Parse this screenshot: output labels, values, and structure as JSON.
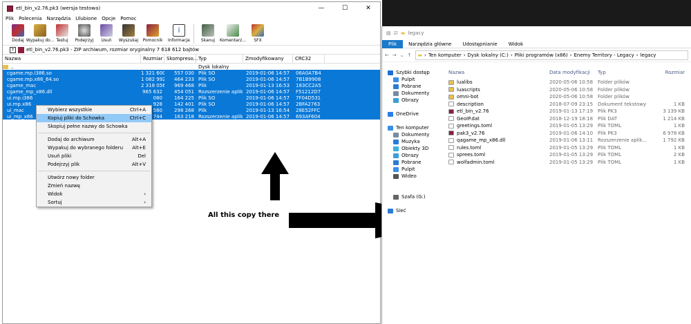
{
  "winrar": {
    "title": "etl_bin_v2.76.pk3 (wersja testowa)",
    "window_controls": [
      "—",
      "☐",
      "✕"
    ],
    "menu": [
      "Plik",
      "Polecenia",
      "Narzędzia",
      "Ulubione",
      "Opcje",
      "Pomoc"
    ],
    "toolbar": [
      "Dodaj",
      "Wypakuj do...",
      "Testuj",
      "Podejrzyj",
      "Usuń",
      "Wyszukaj",
      "Pomocnik",
      "Informacje",
      "Skanuj",
      "Komentarz...",
      "SFX"
    ],
    "path_text": "etl_bin_v2.76.pk3 - ZIP archiwum, rozmiar oryginalny 7 618 612 bajtów",
    "columns": [
      "Nazwa",
      "Rozmiar",
      "Skompreso...",
      "Typ",
      "Zmodyfikowany",
      "CRC32"
    ],
    "rows": [
      {
        "name": "..",
        "size": "",
        "packed": "",
        "type": "Dysk lokalny",
        "modified": "",
        "crc": "",
        "selected": false
      },
      {
        "name": "cgame.mp.i386.so",
        "size": "1 321 600",
        "packed": "557 030",
        "type": "Plik SO",
        "modified": "2019-01-06 14:57",
        "crc": "06A0A7B4",
        "selected": true
      },
      {
        "name": "cgame.mp.x86_64.so",
        "size": "1 082 992",
        "packed": "464 233",
        "type": "Plik SO",
        "modified": "2019-01-06 14:57",
        "crc": "7B1B9908",
        "selected": true
      },
      {
        "name": "cgame_mac",
        "size": "2 318 056",
        "packed": "969 468",
        "type": "Plik",
        "modified": "2019-01-13 16:53",
        "crc": "183CC2A5",
        "selected": true
      },
      {
        "name": "cgame_mp_x86.dll",
        "size": "965 632",
        "packed": "454 051",
        "type": "Rozszerzenie aplik...",
        "modified": "2019-01-06 14:57",
        "crc": "F51212D7",
        "selected": true
      },
      {
        "name": "ui.mp.i386",
        "size": "080",
        "packed": "164 225",
        "type": "Plik SO",
        "modified": "2019-01-06 14:57",
        "crc": "7F04D531",
        "selected": true
      },
      {
        "name": "ui.mp.x86",
        "size": "928",
        "packed": "142 401",
        "type": "Plik SO",
        "modified": "2019-01-06 14:57",
        "crc": "2BFA2763",
        "selected": true
      },
      {
        "name": "ui_mac",
        "size": "580",
        "packed": "298 268",
        "type": "Plik",
        "modified": "2019-01-13 16:54",
        "crc": "28E52FFC",
        "selected": true
      },
      {
        "name": "ui_mp_x86",
        "size": "744",
        "packed": "163 218",
        "type": "Rozszerzenie aplik...",
        "modified": "2019-01-06 14:57",
        "crc": "693AF604",
        "selected": true
      }
    ]
  },
  "context_menu": [
    {
      "label": "Wybierz wszystkie",
      "key": "Ctrl+A"
    },
    {
      "label": "Kopiuj pliki do Schowka",
      "key": "Ctrl+C",
      "highlight": true
    },
    {
      "label": "Skopiuj pełne nazwy do Schowka",
      "key": ""
    },
    {
      "sep": true
    },
    {
      "label": "Dodaj do archiwum",
      "key": "Alt+A"
    },
    {
      "label": "Wypakuj do wybranego folderu",
      "key": "Alt+E"
    },
    {
      "label": "Usuń pliki",
      "key": "Del"
    },
    {
      "label": "Podejrzyj plik",
      "key": "Alt+V"
    },
    {
      "sep": true
    },
    {
      "label": "Utwórz nowy folder",
      "key": ""
    },
    {
      "label": "Zmień nazwę",
      "key": ""
    },
    {
      "label": "Widok",
      "key": "›"
    },
    {
      "label": "Sortuj",
      "key": "›"
    }
  ],
  "annotation": "All this copy there",
  "explorer": {
    "title": "legacy",
    "ribbon": [
      "Plik",
      "Narzędzia główne",
      "Udostępnianie",
      "Widok"
    ],
    "address": [
      "Ten komputer",
      "Dysk lokalny (C:)",
      "Pliki programów (x86)",
      "Enemy Territory - Legacy",
      "legacy"
    ],
    "nav": [
      {
        "label": "Szybki dostęp",
        "color": "#1f6fd1",
        "indent": 0
      },
      {
        "label": "Pulpit",
        "color": "#3a8ee6",
        "indent": 1
      },
      {
        "label": "Pobrane",
        "color": "#2a7bd6",
        "indent": 1
      },
      {
        "label": "Dokumenty",
        "color": "#7a8ca0",
        "indent": 1
      },
      {
        "label": "Obrazy",
        "color": "#3a9fd6",
        "indent": 1
      },
      {
        "label": "",
        "color": "",
        "indent": 0
      },
      {
        "label": "OneDrive",
        "color": "#2b7de9",
        "indent": 0
      },
      {
        "label": "",
        "color": "",
        "indent": 0
      },
      {
        "label": "Ten komputer",
        "color": "#3a8ee6",
        "indent": 0
      },
      {
        "label": "Dokumenty",
        "color": "#7a8ca0",
        "indent": 1
      },
      {
        "label": "Muzyka",
        "color": "#2a7bd6",
        "indent": 1
      },
      {
        "label": "Obiekty 3D",
        "color": "#3ab0e0",
        "indent": 1
      },
      {
        "label": "Obrazy",
        "color": "#3a9fd6",
        "indent": 1
      },
      {
        "label": "Pobrane",
        "color": "#2a7bd6",
        "indent": 1
      },
      {
        "label": "Pulpit",
        "color": "#3a8ee6",
        "indent": 1
      },
      {
        "label": "Wideo",
        "color": "#555",
        "indent": 1
      },
      {
        "label": "",
        "color": "",
        "indent": 0
      },
      {
        "label": "",
        "color": "",
        "indent": 0
      },
      {
        "label": "Szafa (G:)",
        "color": "#666",
        "indent": 1
      },
      {
        "label": "",
        "color": "",
        "indent": 0
      },
      {
        "label": "Sieć",
        "color": "#2a7bd6",
        "indent": 0
      }
    ],
    "columns": [
      "Nazwa",
      "Data modyfikacji",
      "Typ",
      "Rozmiar"
    ],
    "files": [
      {
        "name": "lualibs",
        "date": "2020-05-06 10:58",
        "type": "Folder plików",
        "size": "",
        "color": "#e8c04a"
      },
      {
        "name": "luascripts",
        "date": "2020-05-06 10:58",
        "type": "Folder plików",
        "size": "",
        "color": "#e8c04a"
      },
      {
        "name": "omni-bot",
        "date": "2020-05-06 10:58",
        "type": "Folder plików",
        "size": "",
        "color": "#e8c04a"
      },
      {
        "name": "description",
        "date": "2018-07-09 23:15",
        "type": "Dokument tekstowy",
        "size": "1 KB",
        "color": "#fff"
      },
      {
        "name": "etl_bin_v2.76",
        "date": "2019-01-13 17:19",
        "type": "Plik PK3",
        "size": "3 139 KB",
        "color": "#8a1f3c"
      },
      {
        "name": "GeoIP.dat",
        "date": "2018-12-19 18:18",
        "type": "Plik DAT",
        "size": "1 214 KB",
        "color": "#fff"
      },
      {
        "name": "greetings.toml",
        "date": "2019-01-05 13:29",
        "type": "Plik TOML",
        "size": "1 KB",
        "color": "#fff"
      },
      {
        "name": "pak3_v2.76",
        "date": "2019-01-06 14:10",
        "type": "Plik PK3",
        "size": "6 978 KB",
        "color": "#8a1f3c"
      },
      {
        "name": "qagame_mp_x86.dll",
        "date": "2019-01-06 13:11",
        "type": "Rozszerzenie aplik...",
        "size": "1 792 KB",
        "color": "#fff"
      },
      {
        "name": "rules.toml",
        "date": "2019-01-05 13:29",
        "type": "Plik TOML",
        "size": "1 KB",
        "color": "#fff"
      },
      {
        "name": "sprees.toml",
        "date": "2019-01-05 13:29",
        "type": "Plik TOML",
        "size": "2 KB",
        "color": "#fff"
      },
      {
        "name": "wolfadmin.toml",
        "date": "2019-01-05 13:29",
        "type": "Plik TOML",
        "size": "1 KB",
        "color": "#fff"
      }
    ]
  },
  "colors": {
    "selection": "#0a78d7",
    "menu_highlight": "#91c9f7",
    "ribbon_file": "#1979ca"
  },
  "toolbar_icons": [
    "dodaj-icon",
    "wypakuj-icon",
    "testuj-icon",
    "podejrzyj-icon",
    "usun-icon",
    "wyszukaj-icon",
    "pomocnik-icon",
    "informacje-icon",
    "skanuj-icon",
    "komentarz-icon",
    "sfx-icon"
  ]
}
